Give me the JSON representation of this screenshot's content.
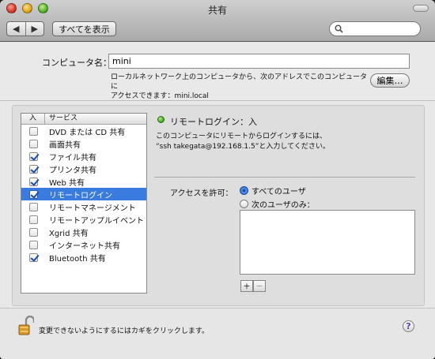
{
  "window": {
    "title": "共有"
  },
  "toolbar": {
    "back_icon": "back-arrow",
    "forward_icon": "forward-arrow",
    "show_all_label": "すべてを表示",
    "search_value": ""
  },
  "computer_name": {
    "label": "コンピュータ名：",
    "value": "mini",
    "description_line1": "ローカルネットワーク上のコンピュータから、次のアドレスでこのコンピュータに",
    "description_line2": "アクセスできます：mini.local",
    "edit_button": "編集…"
  },
  "services": {
    "header_on": "入",
    "header_service": "サービス",
    "items": [
      {
        "label": "DVD または CD 共有",
        "checked": false,
        "selected": false
      },
      {
        "label": "画面共有",
        "checked": false,
        "selected": false
      },
      {
        "label": "ファイル共有",
        "checked": true,
        "selected": false
      },
      {
        "label": "プリンタ共有",
        "checked": true,
        "selected": false
      },
      {
        "label": "Web 共有",
        "checked": true,
        "selected": false
      },
      {
        "label": "リモートログイン",
        "checked": true,
        "selected": true
      },
      {
        "label": "リモートマネージメント",
        "checked": false,
        "selected": false
      },
      {
        "label": "リモートアップルイベント",
        "checked": false,
        "selected": false
      },
      {
        "label": "Xgrid 共有",
        "checked": false,
        "selected": false
      },
      {
        "label": "インターネット共有",
        "checked": false,
        "selected": false
      },
      {
        "label": "Bluetooth 共有",
        "checked": true,
        "selected": false
      }
    ]
  },
  "detail": {
    "status_text": "リモートログイン：入",
    "status_color": "#3aa017",
    "description_line1": "このコンピュータにリモートからログインするには、",
    "description_line2": "“ssh takegata@192.168.1.5”と入力してください。",
    "access_label": "アクセスを許可：",
    "radio_all": "すべてのユーザ",
    "radio_only": "次のユーザのみ：",
    "add_label": "+",
    "remove_label": "−"
  },
  "footer": {
    "lock_text": "変更できないようにするにはカギをクリックします。",
    "help_label": "?"
  }
}
